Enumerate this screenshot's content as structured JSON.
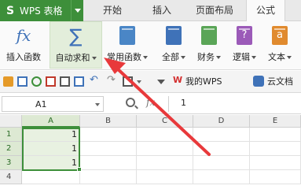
{
  "app": {
    "title": "WPS 表格",
    "logo": "S"
  },
  "tabs": [
    {
      "label": "开始",
      "active": false
    },
    {
      "label": "插入",
      "active": false
    },
    {
      "label": "页面布局",
      "active": false
    },
    {
      "label": "公式",
      "active": true
    }
  ],
  "ribbon": {
    "insert_function": "插入函数",
    "autosum": "自动求和",
    "common_functions": "常用函数",
    "all": "全部",
    "finance": "财务",
    "logic": "逻辑",
    "text": "文本",
    "fx_glyph": "fx",
    "sigma_glyph": "∑",
    "logic_glyph": "?",
    "text_glyph": "a"
  },
  "quickbar": {
    "my_wps": "我的WPS",
    "cloud_docs": "云文档"
  },
  "formula_bar": {
    "cell_ref": "A1",
    "fx_label": "fx",
    "value": "1"
  },
  "sheet": {
    "columns": [
      "A",
      "B",
      "C",
      "D",
      "E"
    ],
    "rows": [
      "1",
      "2",
      "3",
      "4"
    ],
    "cells": {
      "A1": "1",
      "A2": "1",
      "A3": "1"
    }
  },
  "colors": {
    "accent": "#3d8f3a",
    "arrow": "#e8393b"
  }
}
